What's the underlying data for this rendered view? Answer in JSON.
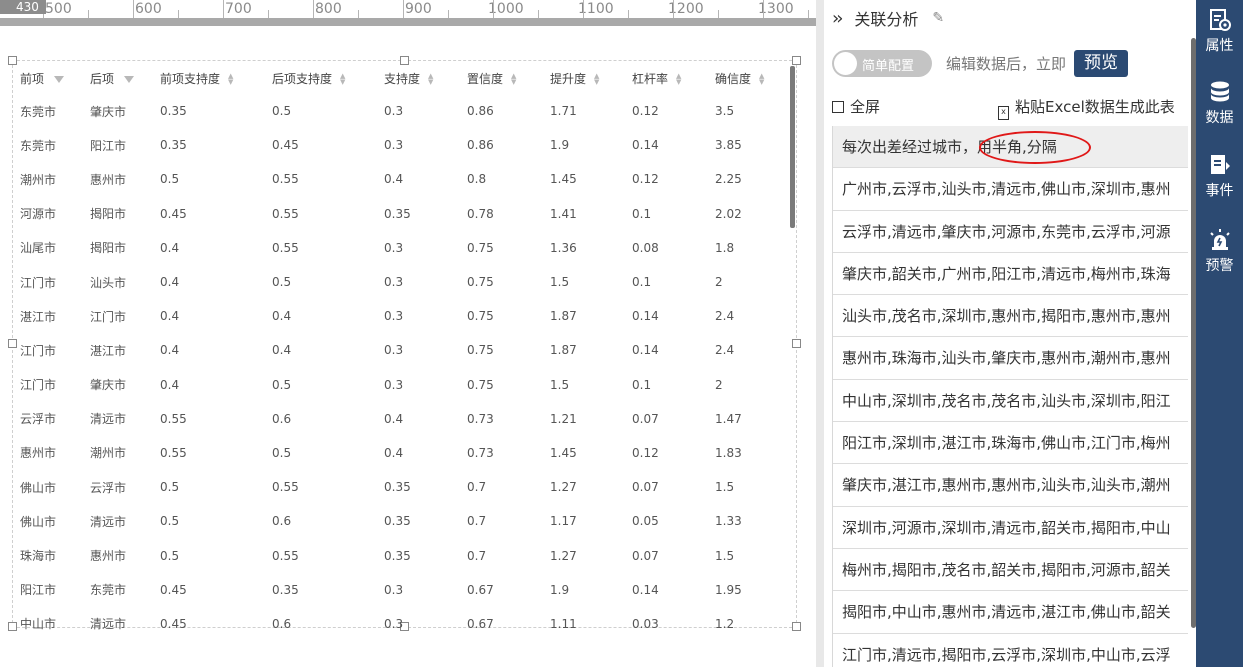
{
  "ruler": {
    "corner": "430",
    "ticks": [
      "500",
      "600",
      "700",
      "800",
      "900",
      "1000",
      "1100",
      "1200",
      "1300"
    ]
  },
  "table": {
    "columns": [
      "前项",
      "后项",
      "前项支持度",
      "后项支持度",
      "支持度",
      "置信度",
      "提升度",
      "杠杆率",
      "确信度"
    ],
    "rows": [
      [
        "东莞市",
        "肇庆市",
        "0.35",
        "0.5",
        "0.3",
        "0.86",
        "1.71",
        "0.12",
        "3.5"
      ],
      [
        "东莞市",
        "阳江市",
        "0.35",
        "0.45",
        "0.3",
        "0.86",
        "1.9",
        "0.14",
        "3.85"
      ],
      [
        "潮州市",
        "惠州市",
        "0.5",
        "0.55",
        "0.4",
        "0.8",
        "1.45",
        "0.12",
        "2.25"
      ],
      [
        "河源市",
        "揭阳市",
        "0.45",
        "0.55",
        "0.35",
        "0.78",
        "1.41",
        "0.1",
        "2.02"
      ],
      [
        "汕尾市",
        "揭阳市",
        "0.4",
        "0.55",
        "0.3",
        "0.75",
        "1.36",
        "0.08",
        "1.8"
      ],
      [
        "江门市",
        "汕头市",
        "0.4",
        "0.5",
        "0.3",
        "0.75",
        "1.5",
        "0.1",
        "2"
      ],
      [
        "湛江市",
        "江门市",
        "0.4",
        "0.4",
        "0.3",
        "0.75",
        "1.87",
        "0.14",
        "2.4"
      ],
      [
        "江门市",
        "湛江市",
        "0.4",
        "0.4",
        "0.3",
        "0.75",
        "1.87",
        "0.14",
        "2.4"
      ],
      [
        "江门市",
        "肇庆市",
        "0.4",
        "0.5",
        "0.3",
        "0.75",
        "1.5",
        "0.1",
        "2"
      ],
      [
        "云浮市",
        "清远市",
        "0.55",
        "0.6",
        "0.4",
        "0.73",
        "1.21",
        "0.07",
        "1.47"
      ],
      [
        "惠州市",
        "潮州市",
        "0.55",
        "0.5",
        "0.4",
        "0.73",
        "1.45",
        "0.12",
        "1.83"
      ],
      [
        "佛山市",
        "云浮市",
        "0.5",
        "0.55",
        "0.35",
        "0.7",
        "1.27",
        "0.07",
        "1.5"
      ],
      [
        "佛山市",
        "清远市",
        "0.5",
        "0.6",
        "0.35",
        "0.7",
        "1.17",
        "0.05",
        "1.33"
      ],
      [
        "珠海市",
        "惠州市",
        "0.5",
        "0.55",
        "0.35",
        "0.7",
        "1.27",
        "0.07",
        "1.5"
      ],
      [
        "阳江市",
        "东莞市",
        "0.45",
        "0.35",
        "0.3",
        "0.67",
        "1.9",
        "0.14",
        "1.95"
      ],
      [
        "中山市",
        "清远市",
        "0.45",
        "0.6",
        "0.3",
        "0.67",
        "1.11",
        "0.03",
        "1.2"
      ]
    ]
  },
  "panel": {
    "collapse_icon": "double-chevron-right-icon",
    "title": "关联分析",
    "toggle_label": "简单配置",
    "hint": "编辑数据后，立即",
    "preview_label": "预览",
    "fullscreen_label": "全屏",
    "paste_label": "粘贴Excel数据生成此表",
    "data_header": "每次出差经过城市，用半角,分隔",
    "data_rows": [
      "广州市,云浮市,汕头市,清远市,佛山市,深圳市,惠州",
      "云浮市,清远市,肇庆市,河源市,东莞市,云浮市,河源",
      "肇庆市,韶关市,广州市,阳江市,清远市,梅州市,珠海",
      "汕头市,茂名市,深圳市,惠州市,揭阳市,惠州市,惠州",
      "惠州市,珠海市,汕头市,肇庆市,惠州市,潮州市,惠州",
      "中山市,深圳市,茂名市,茂名市,汕头市,深圳市,阳江",
      "阳江市,深圳市,湛江市,珠海市,佛山市,江门市,梅州",
      "肇庆市,湛江市,惠州市,惠州市,汕头市,汕头市,潮州",
      "深圳市,河源市,深圳市,清远市,韶关市,揭阳市,中山",
      "梅州市,揭阳市,茂名市,韶关市,揭阳市,河源市,韶关",
      "揭阳市,中山市,惠州市,清远市,湛江市,佛山市,韶关",
      "江门市,清远市,揭阳市,云浮市,深圳市,中山市,云浮"
    ]
  },
  "tabs": [
    {
      "label": "属性",
      "icon": "properties-icon"
    },
    {
      "label": "数据",
      "icon": "database-icon"
    },
    {
      "label": "事件",
      "icon": "event-icon"
    },
    {
      "label": "预警",
      "icon": "alarm-icon"
    }
  ],
  "colors": {
    "tabbar": "#2c4a72",
    "preview_button": "#2b4a73",
    "annotation_circle": "#e01818"
  }
}
